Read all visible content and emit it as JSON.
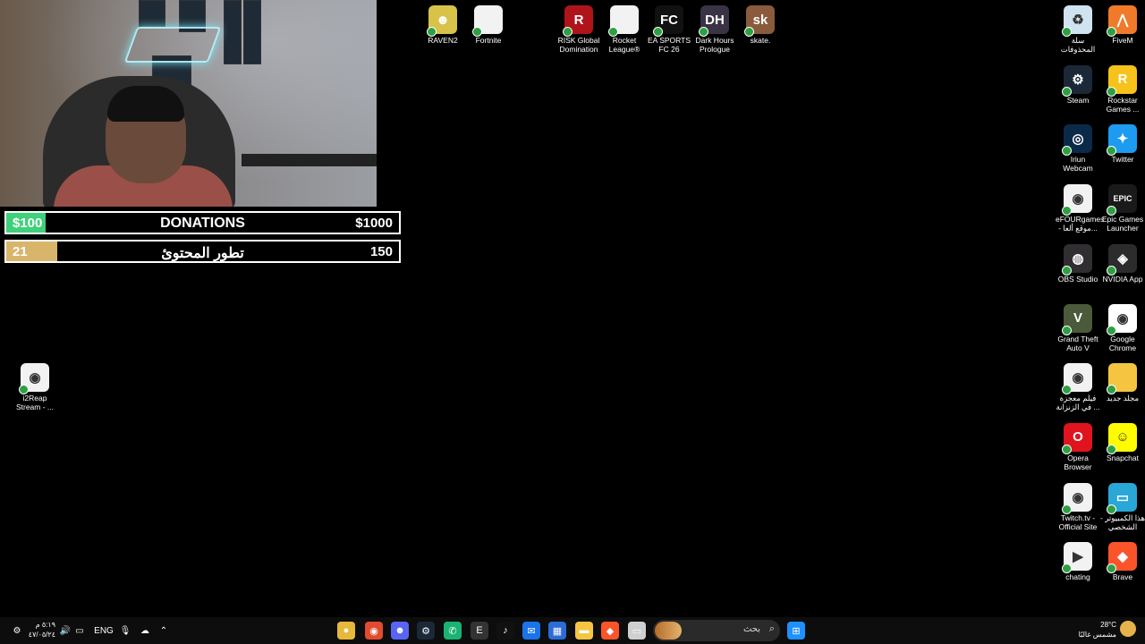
{
  "overlay": {
    "donations": {
      "min": "$100",
      "title": "DONATIONS",
      "max": "$1000",
      "progress": 0.1
    },
    "content": {
      "current": "21",
      "title": "تطور المحتوئ",
      "target": "150",
      "progress": 0.13
    }
  },
  "desktop": {
    "top_icons": [
      {
        "label": "RAVEN2",
        "icon": "raven2-icon",
        "color": "#d8c24a",
        "glyph": "☻"
      },
      {
        "label": "Fortnite",
        "icon": "file-icon",
        "color": "#f2f2f2",
        "glyph": ""
      },
      {
        "label": "RISK Global Domination",
        "icon": "risk-icon",
        "color": "#b0141b",
        "glyph": "R"
      },
      {
        "label": "Rocket League®",
        "icon": "file-icon",
        "color": "#f2f2f2",
        "glyph": ""
      },
      {
        "label": "EA SPORTS FC 26",
        "icon": "ea-fc-icon",
        "color": "#111111",
        "glyph": "FC"
      },
      {
        "label": "Dark Hours Prologue",
        "icon": "dark-hours-icon",
        "color": "#3a3346",
        "glyph": "DH"
      },
      {
        "label": "skate.",
        "icon": "skate-icon",
        "color": "#8a5a3c",
        "glyph": "sk"
      }
    ],
    "left_icons": [
      {
        "label": "i2Reap Stream - ...",
        "icon": "chrome-file-icon",
        "color": "#f2f2f2",
        "glyph": "◉"
      }
    ],
    "right_icons": [
      {
        "label": "سلة المحذوفات",
        "icon": "recycle-bin-icon",
        "color": "#cfe3f0",
        "glyph": "♻"
      },
      {
        "label": "FiveM",
        "icon": "fivem-icon",
        "color": "#f07a2a",
        "glyph": "⋀"
      },
      {
        "label": "Steam",
        "icon": "steam-icon",
        "color": "#1b2838",
        "glyph": "⚙"
      },
      {
        "label": "Rockstar Games ...",
        "icon": "rockstar-icon",
        "color": "#f6c21b",
        "glyph": "R"
      },
      {
        "label": "Iriun Webcam",
        "icon": "webcam-icon",
        "color": "#0b2a4a",
        "glyph": "◎"
      },
      {
        "label": "Twitter",
        "icon": "twitter-icon",
        "color": "#1d9bf0",
        "glyph": "✦"
      },
      {
        "label": "eFOURgames - موقع ألعا...",
        "icon": "chrome-file-icon",
        "color": "#f2f2f2",
        "glyph": "◉"
      },
      {
        "label": "Epic Games Launcher",
        "icon": "epic-icon",
        "color": "#1a1a1a",
        "glyph": "EPIC"
      },
      {
        "label": "OBS Studio",
        "icon": "obs-icon",
        "color": "#302e31",
        "glyph": "◍"
      },
      {
        "label": "NVIDIA App",
        "icon": "nvidia-icon",
        "color": "#2c2c2c",
        "glyph": "◈"
      },
      {
        "label": "Grand Theft Auto V",
        "icon": "gta-icon",
        "color": "#4a5a3a",
        "glyph": "V"
      },
      {
        "label": "Google Chrome",
        "icon": "chrome-icon",
        "color": "#ffffff",
        "glyph": "◉"
      },
      {
        "label": "فيلم معجزة في الزنزانة ...",
        "icon": "chrome-file-icon",
        "color": "#f2f2f2",
        "glyph": "◉"
      },
      {
        "label": "مجلد جديد",
        "icon": "folder-icon",
        "color": "#f5c542",
        "glyph": ""
      },
      {
        "label": "Opera Browser",
        "icon": "opera-icon",
        "color": "#e0141e",
        "glyph": "O"
      },
      {
        "label": "Snapchat",
        "icon": "snapchat-icon",
        "color": "#fffc00",
        "glyph": "☺"
      },
      {
        "label": "Twitch.tv - Official Site",
        "icon": "chrome-file-icon",
        "color": "#f2f2f2",
        "glyph": "◉"
      },
      {
        "label": "هذا الكمبيوتر - الشخصي",
        "icon": "this-pc-icon",
        "color": "#29a7d6",
        "glyph": "▭"
      },
      {
        "label": "chating",
        "icon": "media-file-icon",
        "color": "#f2f2f2",
        "glyph": "▶"
      },
      {
        "label": "Brave",
        "icon": "brave-icon",
        "color": "#fb542b",
        "glyph": "◆"
      }
    ]
  },
  "taskbar": {
    "start_icon": "windows-start-icon",
    "search_text": "بحث",
    "apps": [
      {
        "name": "explorer-app-icon",
        "color": "#e7b93a",
        "glyph": "●"
      },
      {
        "name": "chrome-app-icon",
        "color": "#e24b2f",
        "glyph": "◉"
      },
      {
        "name": "discord-app-icon",
        "color": "#5865f2",
        "glyph": "☻"
      },
      {
        "name": "steam-app-icon",
        "color": "#1b2838",
        "glyph": "⚙"
      },
      {
        "name": "whatsapp-app-icon",
        "color": "#19b374",
        "glyph": "✆"
      },
      {
        "name": "epic-app-icon",
        "color": "#333333",
        "glyph": "E"
      },
      {
        "name": "tiktok-app-icon",
        "color": "#111111",
        "glyph": "♪"
      },
      {
        "name": "outlook-app-icon",
        "color": "#1a73e8",
        "glyph": "✉"
      },
      {
        "name": "store-app-icon",
        "color": "#2b6cd6",
        "glyph": "▦"
      },
      {
        "name": "file-explorer-app-icon",
        "color": "#f5c542",
        "glyph": "▬"
      },
      {
        "name": "brave-app-icon",
        "color": "#fb542b",
        "glyph": "◆"
      },
      {
        "name": "window-app-icon",
        "color": "#cfcfcf",
        "glyph": "▭"
      }
    ],
    "tray": {
      "language": "ENG",
      "time": "٥:١٩ م",
      "date": "٤٧/٠٥/٢٤",
      "temperature": "28°C",
      "weather": "مشمس غالبًا"
    }
  }
}
